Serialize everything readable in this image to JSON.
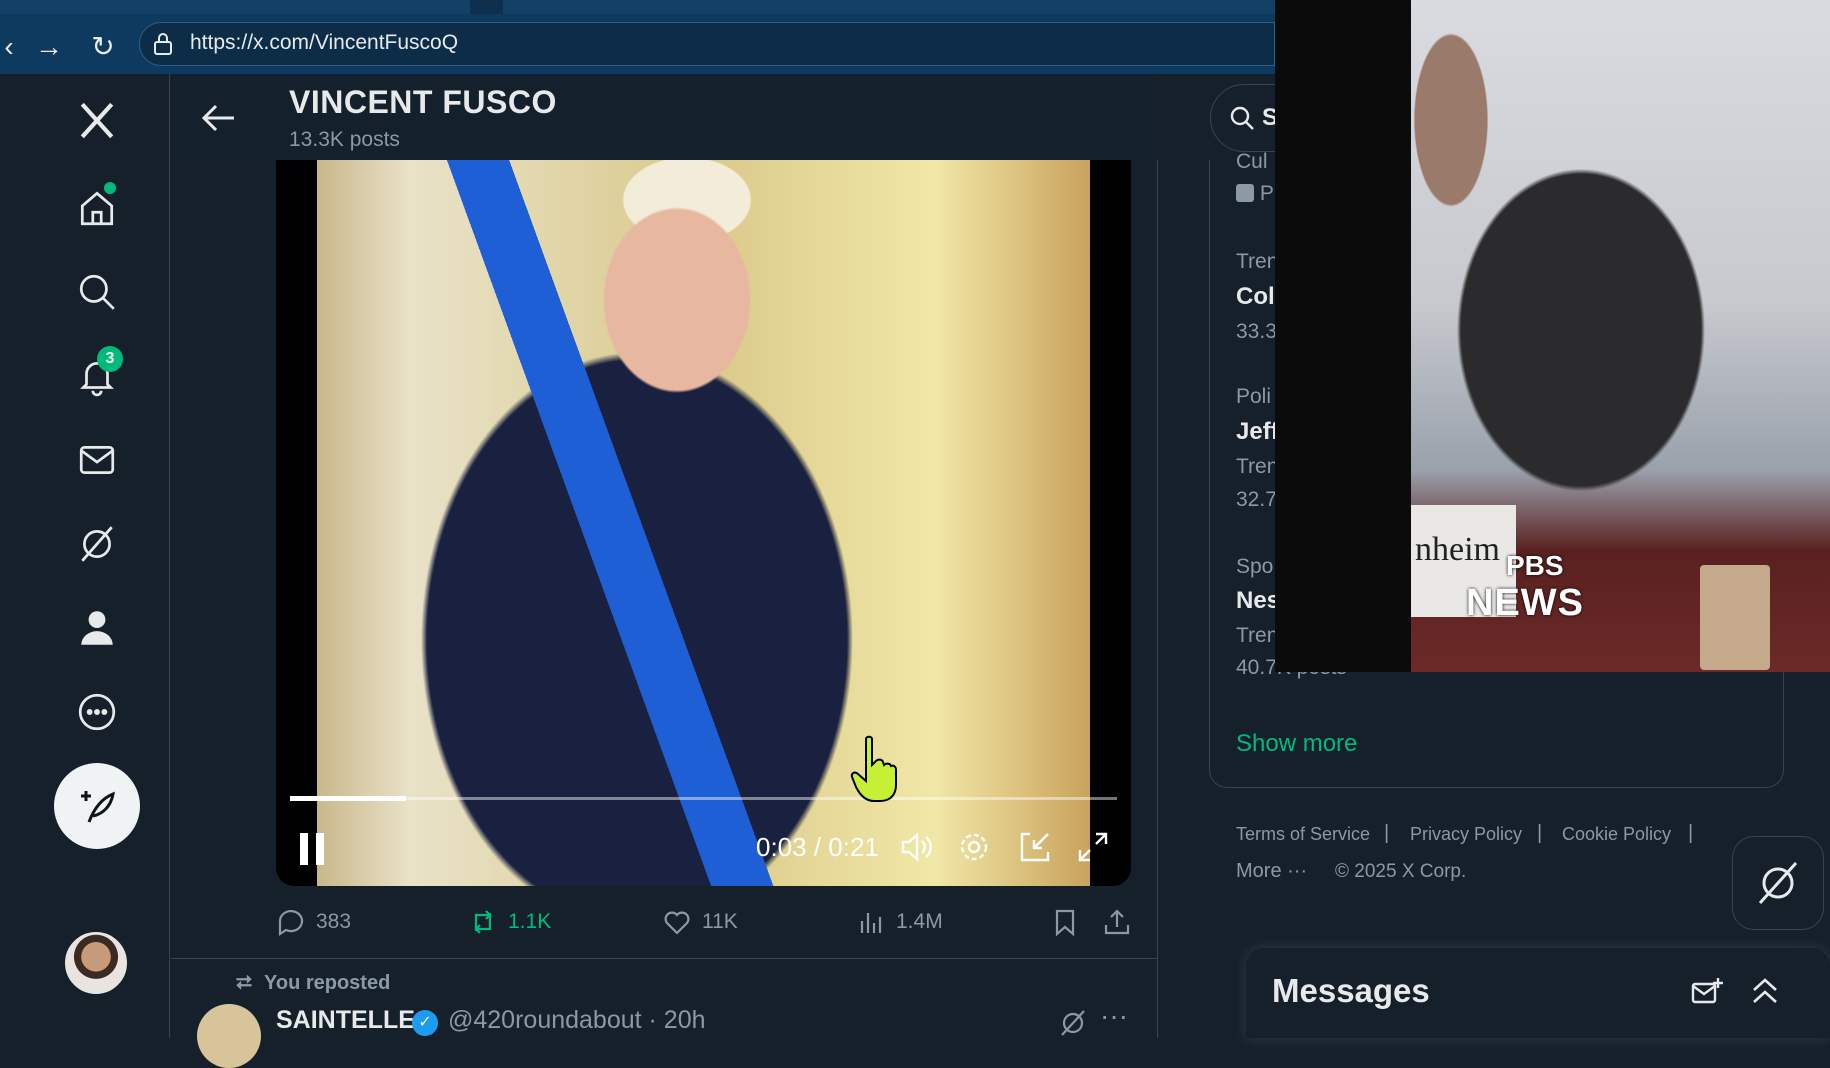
{
  "browser": {
    "url": "https://x.com/VincentFuscoQ"
  },
  "profile": {
    "name": "VINCENT FUSCO",
    "post_count": "13.3K posts"
  },
  "nav": {
    "notifications_badge": "3"
  },
  "video": {
    "time": "0:03 / 0:21",
    "progress_fraction": 0.14
  },
  "post_actions": {
    "replies": "383",
    "reposts": "1.1K",
    "likes": "11K",
    "views": "1.4M"
  },
  "next_post": {
    "reposted_label": "You reposted",
    "name": "SAINTELLE",
    "handle_time": "@420roundabout · 20h"
  },
  "right": {
    "search_partial": "S",
    "trends": [
      {
        "category": "Cul",
        "title": "P"
      },
      {
        "category": "Tren",
        "title": "Col",
        "count": "33.3"
      },
      {
        "category": "Poli",
        "title": "Jeff",
        "meta": "Tren",
        "count": "32.7"
      },
      {
        "category": "Spo",
        "title": "Nes",
        "meta": "Tren",
        "count": "40.7K posts"
      }
    ],
    "show_more": "Show more",
    "footer": {
      "terms": "Terms of Service",
      "privacy": "Privacy Policy",
      "cookie": "Cookie Policy",
      "more": "More ···",
      "copyright": "© 2025 X Corp."
    },
    "messages_title": "Messages"
  },
  "pip": {
    "logo_line1": "PBS",
    "logo_line2": "NEWS",
    "nameplate": "nheim"
  },
  "colors": {
    "accent": "#00ba7c",
    "background": "#15202b",
    "muted": "#8b98a5"
  }
}
